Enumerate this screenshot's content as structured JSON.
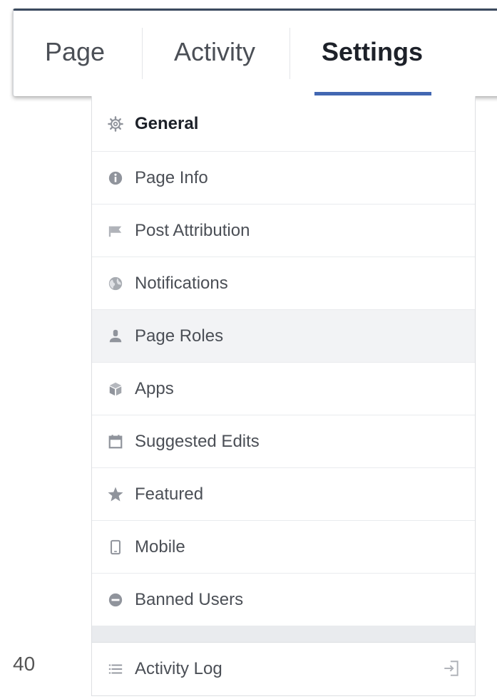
{
  "tabs": {
    "page": "Page",
    "activity": "Activity",
    "settings": "Settings",
    "active": "Settings"
  },
  "menu": {
    "items": [
      {
        "label": "General",
        "icon": "gear-icon",
        "selected": true
      },
      {
        "label": "Page Info",
        "icon": "info-icon"
      },
      {
        "label": "Post Attribution",
        "icon": "flag-icon"
      },
      {
        "label": "Notifications",
        "icon": "globe-icon"
      },
      {
        "label": "Page Roles",
        "icon": "person-icon",
        "hovered": true
      },
      {
        "label": "Apps",
        "icon": "cube-icon"
      },
      {
        "label": "Suggested Edits",
        "icon": "calendar-icon"
      },
      {
        "label": "Featured",
        "icon": "star-icon"
      },
      {
        "label": "Mobile",
        "icon": "phone-icon"
      },
      {
        "label": "Banned Users",
        "icon": "minus-circle-icon"
      }
    ],
    "footer": {
      "label": "Activity Log",
      "icon": "list-icon",
      "trailing_icon": "sign-in-icon"
    }
  },
  "page_number": "40",
  "colors": {
    "accent": "#4267b2",
    "text": "#4b4f56",
    "icon": "#90949c"
  }
}
